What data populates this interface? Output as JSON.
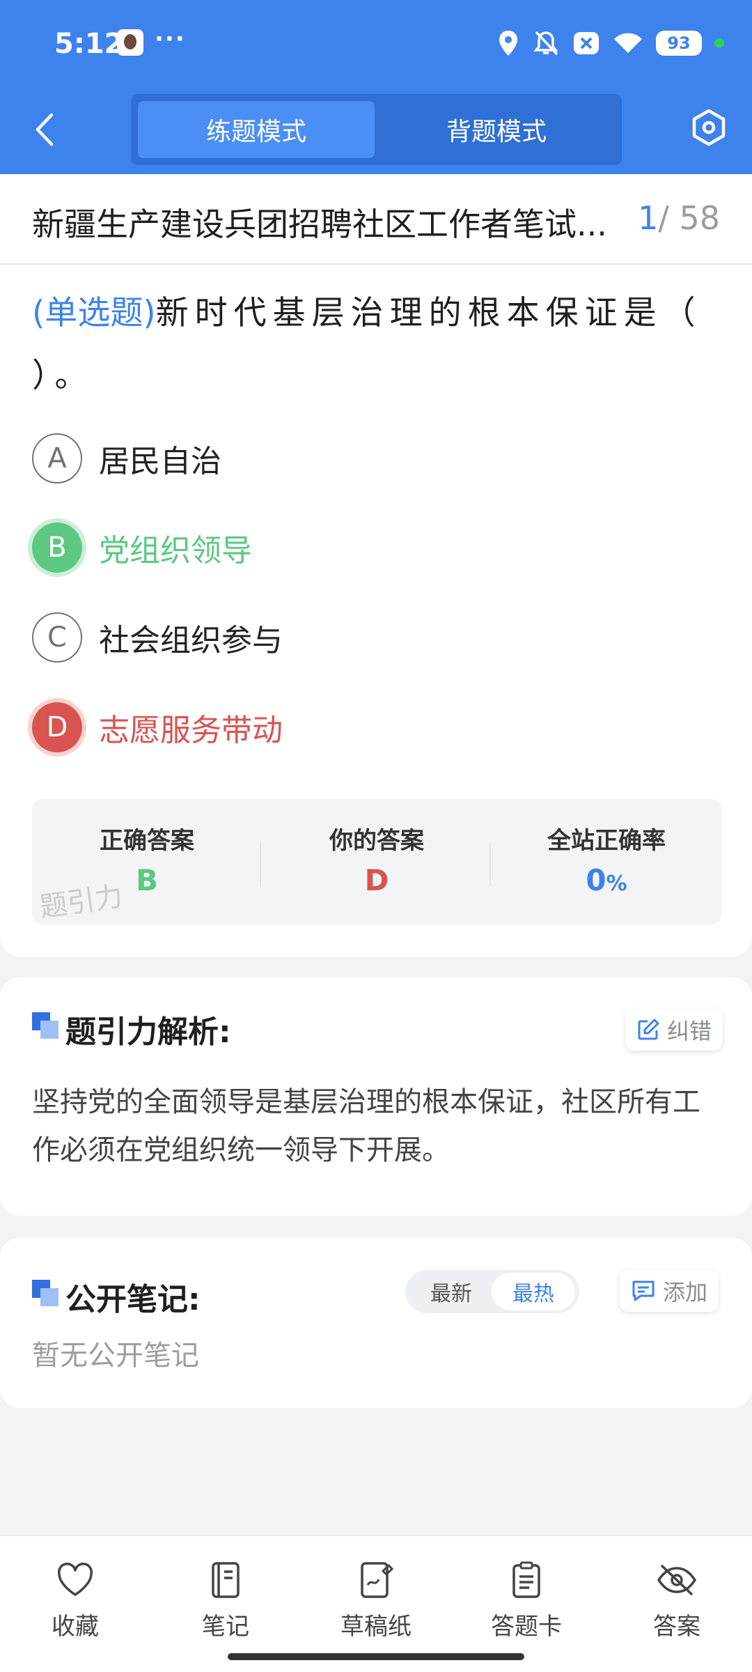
{
  "status_bar": {
    "time": "5:12",
    "more": "···",
    "battery": "93"
  },
  "nav": {
    "mode_practice": "练题模式",
    "mode_recite": "背题模式"
  },
  "exam": {
    "title": "新疆生产建设兵团招聘社区工作者笔试...",
    "current": "1",
    "total": "/ 58"
  },
  "question": {
    "type_label": "(单选题)",
    "text": "新时代基层治理的根本保证是（ ）。",
    "options": [
      {
        "letter": "A",
        "text": "居民自治",
        "state": "normal"
      },
      {
        "letter": "B",
        "text": "党组织领导",
        "state": "correct"
      },
      {
        "letter": "C",
        "text": "社会组织参与",
        "state": "normal"
      },
      {
        "letter": "D",
        "text": "志愿服务带动",
        "state": "wrong"
      }
    ]
  },
  "stats": {
    "correct_label": "正确答案",
    "correct_value": "B",
    "yours_label": "你的答案",
    "yours_value": "D",
    "rate_label": "全站正确率",
    "rate_value": "0",
    "rate_unit": "%",
    "watermark": "题引力"
  },
  "analysis": {
    "title": "题引力解析:",
    "report_label": "纠错",
    "text": "坚持党的全面领导是基层治理的根本保证，社区所有工作必须在党组织统一领导下开展。"
  },
  "notes": {
    "title": "公开笔记:",
    "sort_new": "最新",
    "sort_hot": "最热",
    "add_label": "添加",
    "empty_text": "暂无公开笔记"
  },
  "tabs": [
    {
      "label": "收藏",
      "icon": "heart-icon"
    },
    {
      "label": "笔记",
      "icon": "notebook-icon"
    },
    {
      "label": "草稿纸",
      "icon": "draft-paper-icon"
    },
    {
      "label": "答题卡",
      "icon": "answer-sheet-icon"
    },
    {
      "label": "答案",
      "icon": "eye-off-icon"
    }
  ],
  "colors": {
    "primary": "#3e82ed",
    "correct": "#5cc882",
    "wrong": "#d9534f"
  }
}
